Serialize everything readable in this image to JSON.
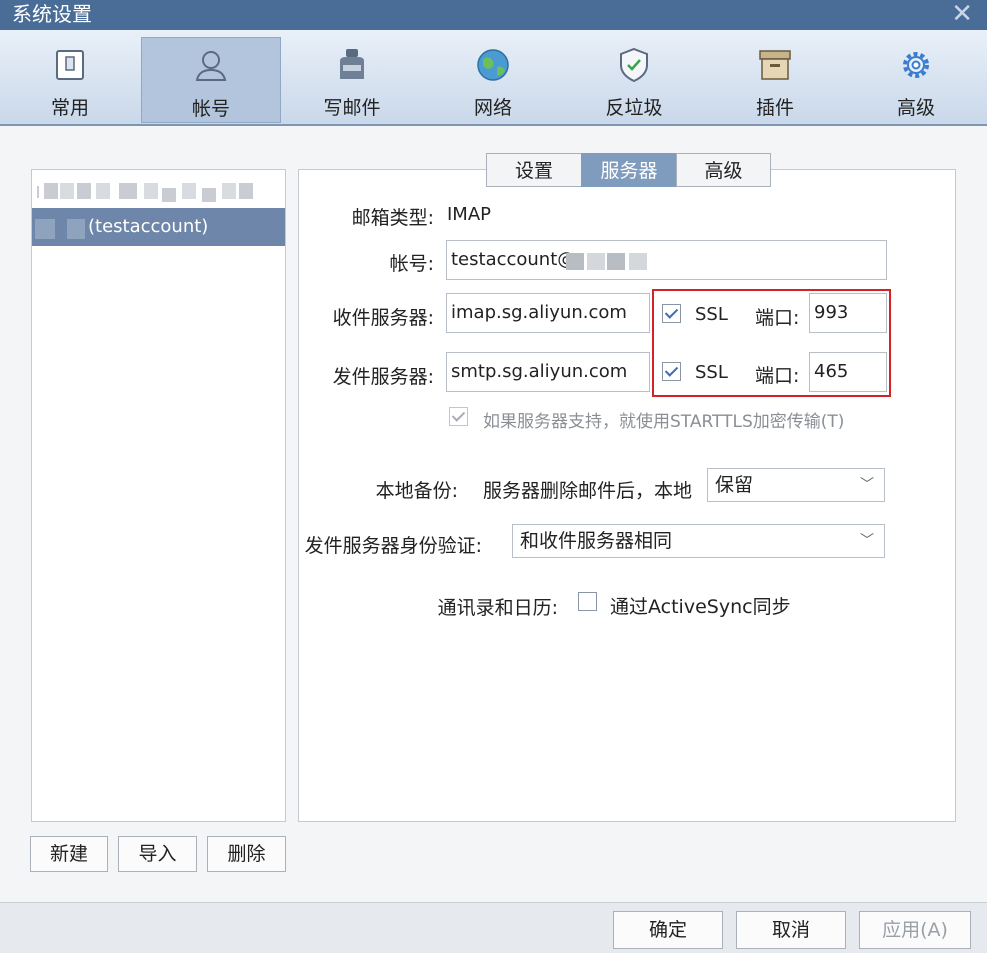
{
  "window": {
    "title": "系统设置",
    "close_glyph": "✕"
  },
  "toolbar": {
    "items": [
      {
        "label": "常用",
        "icon": "phone-icon"
      },
      {
        "label": "帐号",
        "icon": "user-icon"
      },
      {
        "label": "写邮件",
        "icon": "ink-bottle-icon"
      },
      {
        "label": "网络",
        "icon": "globe-icon"
      },
      {
        "label": "反垃圾",
        "icon": "shield-icon"
      },
      {
        "label": "插件",
        "icon": "box-icon"
      },
      {
        "label": "高级",
        "icon": "gear-icon"
      }
    ],
    "active_index": 1
  },
  "accounts": {
    "selected_suffix": "(testaccount)"
  },
  "account_buttons": {
    "new": "新建",
    "import": "导入",
    "delete": "删除"
  },
  "tabs": [
    "设置",
    "服务器",
    "高级"
  ],
  "active_tab": "服务器",
  "form": {
    "mailbox_type_label": "邮箱类型:",
    "mailbox_type_value": "IMAP",
    "account_label": "帐号:",
    "account_value": "testaccount@",
    "incoming_label": "收件服务器:",
    "incoming_value": "imap.sg.aliyun.com",
    "outgoing_label": "发件服务器:",
    "outgoing_value": "smtp.sg.aliyun.com",
    "ssl_label": "SSL",
    "port_label": "端口:",
    "incoming_port": "993",
    "outgoing_port": "465",
    "starttls_label": "如果服务器支持，就使用STARTTLS加密传输(T)",
    "backup_label": "本地备份:",
    "backup_desc": "服务器删除邮件后，本地",
    "backup_value": "保留",
    "auth_label": "发件服务器身份验证:",
    "auth_value": "和收件服务器相同",
    "sync_label": "通讯录和日历:",
    "sync_option": "通过ActiveSync同步"
  },
  "footer": {
    "ok": "确定",
    "cancel": "取消",
    "apply": "应用(A)"
  },
  "colors": {
    "accent": "#4a6d97",
    "selected_row": "#6d86a9",
    "active_tab": "#7f9bbd",
    "highlight_border": "#d2232a"
  }
}
